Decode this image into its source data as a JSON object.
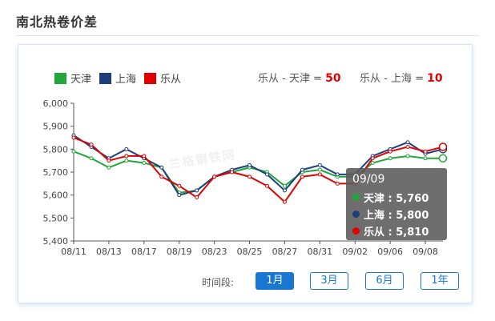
{
  "page": {
    "title": "南北热卷价差"
  },
  "legend": [
    {
      "name": "天津",
      "color": "#20a63a"
    },
    {
      "name": "上海",
      "color": "#1c3f7a"
    },
    {
      "name": "乐从",
      "color": "#e00000"
    }
  ],
  "spreads": [
    {
      "label": "乐从 - 天津 =",
      "value": "50"
    },
    {
      "label": "乐从 - 上海 =",
      "value": "10"
    }
  ],
  "tooltip": {
    "date": "09/09",
    "rows": [
      {
        "label": "天津 : 5,760",
        "color": "#20a63a"
      },
      {
        "label": "上海 : 5,800",
        "color": "#1c3f7a"
      },
      {
        "label": "乐从 : 5,810",
        "color": "#e00000"
      }
    ]
  },
  "period": {
    "label": "时间段:",
    "options": [
      "1月",
      "3月",
      "6月",
      "1年"
    ],
    "selected": "1月"
  },
  "watermark": "兰格钢铁网",
  "chart_data": {
    "type": "line",
    "categories": [
      "08/11",
      "08/12",
      "08/13",
      "08/14",
      "08/17",
      "08/18",
      "08/19",
      "08/20",
      "08/23",
      "08/24",
      "08/25",
      "08/26",
      "08/27",
      "08/30",
      "08/31",
      "09/01",
      "09/02",
      "09/03",
      "09/06",
      "09/07",
      "09/08",
      "09/09"
    ],
    "x_tick_labels": [
      "08/11",
      "08/13",
      "08/17",
      "08/19",
      "08/23",
      "08/25",
      "08/27",
      "08/31",
      "09/02",
      "09/06",
      "09/08"
    ],
    "y_tick_labels": [
      "5,400",
      "5,500",
      "5,600",
      "5,700",
      "5,800",
      "5,900",
      "6,000"
    ],
    "ylim": [
      5400,
      6000
    ],
    "grid": false,
    "series": [
      {
        "name": "天津",
        "color": "#20a63a",
        "values": [
          5790,
          5760,
          5720,
          5750,
          5740,
          5720,
          5610,
          5620,
          5680,
          5700,
          5720,
          5700,
          5640,
          5700,
          5710,
          5680,
          5680,
          5740,
          5760,
          5770,
          5760,
          5760
        ]
      },
      {
        "name": "上海",
        "color": "#1c3f7a",
        "values": [
          5860,
          5810,
          5760,
          5800,
          5760,
          5720,
          5600,
          5620,
          5680,
          5710,
          5730,
          5690,
          5620,
          5710,
          5730,
          5690,
          5690,
          5770,
          5800,
          5830,
          5780,
          5800
        ]
      },
      {
        "name": "乐从",
        "color": "#e00000",
        "values": [
          5850,
          5820,
          5750,
          5770,
          5770,
          5680,
          5640,
          5590,
          5680,
          5700,
          5680,
          5640,
          5570,
          5680,
          5690,
          5650,
          5650,
          5760,
          5790,
          5810,
          5790,
          5810
        ]
      }
    ]
  }
}
